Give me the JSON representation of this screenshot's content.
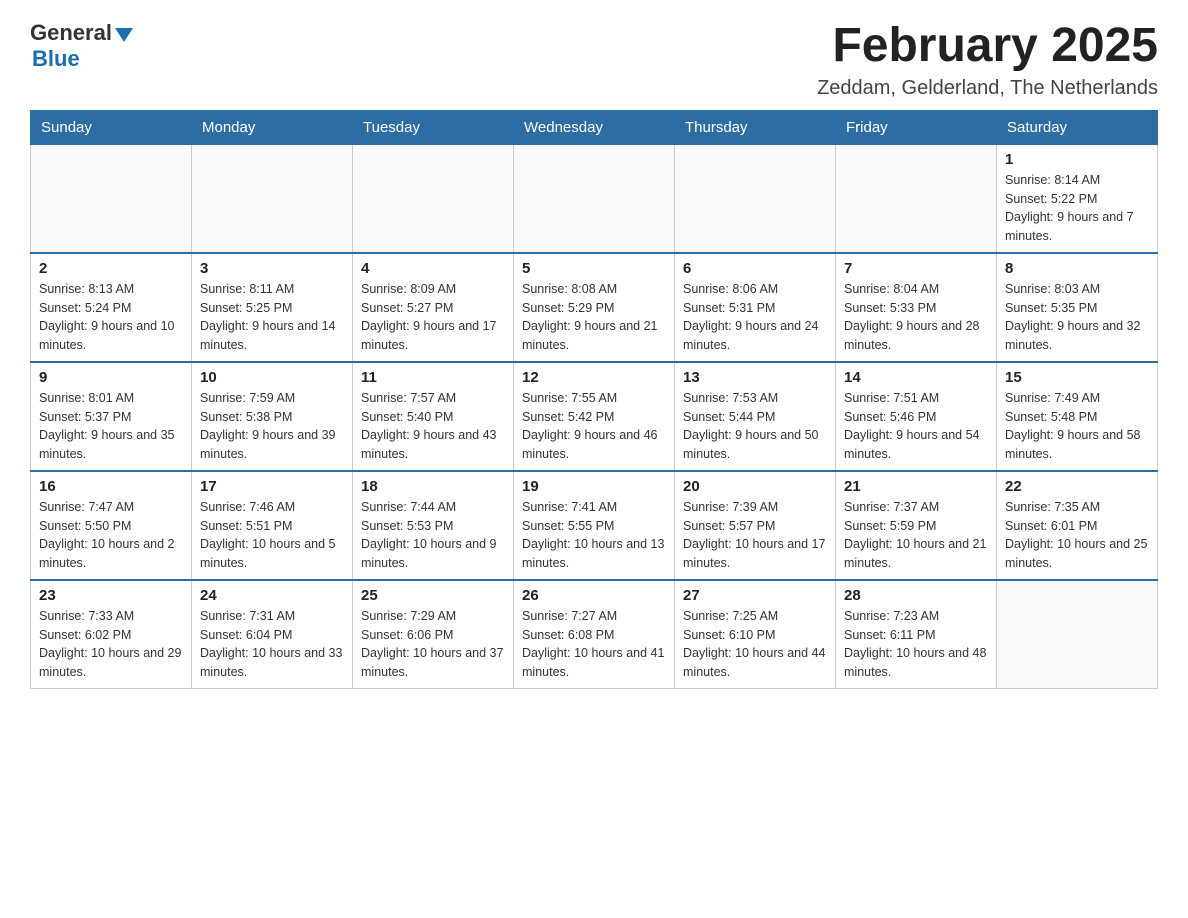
{
  "header": {
    "logo_general": "General",
    "logo_blue": "Blue",
    "title": "February 2025",
    "subtitle": "Zeddam, Gelderland, The Netherlands"
  },
  "weekdays": [
    "Sunday",
    "Monday",
    "Tuesday",
    "Wednesday",
    "Thursday",
    "Friday",
    "Saturday"
  ],
  "weeks": [
    [
      {
        "day": "",
        "info": ""
      },
      {
        "day": "",
        "info": ""
      },
      {
        "day": "",
        "info": ""
      },
      {
        "day": "",
        "info": ""
      },
      {
        "day": "",
        "info": ""
      },
      {
        "day": "",
        "info": ""
      },
      {
        "day": "1",
        "info": "Sunrise: 8:14 AM\nSunset: 5:22 PM\nDaylight: 9 hours and 7 minutes."
      }
    ],
    [
      {
        "day": "2",
        "info": "Sunrise: 8:13 AM\nSunset: 5:24 PM\nDaylight: 9 hours and 10 minutes."
      },
      {
        "day": "3",
        "info": "Sunrise: 8:11 AM\nSunset: 5:25 PM\nDaylight: 9 hours and 14 minutes."
      },
      {
        "day": "4",
        "info": "Sunrise: 8:09 AM\nSunset: 5:27 PM\nDaylight: 9 hours and 17 minutes."
      },
      {
        "day": "5",
        "info": "Sunrise: 8:08 AM\nSunset: 5:29 PM\nDaylight: 9 hours and 21 minutes."
      },
      {
        "day": "6",
        "info": "Sunrise: 8:06 AM\nSunset: 5:31 PM\nDaylight: 9 hours and 24 minutes."
      },
      {
        "day": "7",
        "info": "Sunrise: 8:04 AM\nSunset: 5:33 PM\nDaylight: 9 hours and 28 minutes."
      },
      {
        "day": "8",
        "info": "Sunrise: 8:03 AM\nSunset: 5:35 PM\nDaylight: 9 hours and 32 minutes."
      }
    ],
    [
      {
        "day": "9",
        "info": "Sunrise: 8:01 AM\nSunset: 5:37 PM\nDaylight: 9 hours and 35 minutes."
      },
      {
        "day": "10",
        "info": "Sunrise: 7:59 AM\nSunset: 5:38 PM\nDaylight: 9 hours and 39 minutes."
      },
      {
        "day": "11",
        "info": "Sunrise: 7:57 AM\nSunset: 5:40 PM\nDaylight: 9 hours and 43 minutes."
      },
      {
        "day": "12",
        "info": "Sunrise: 7:55 AM\nSunset: 5:42 PM\nDaylight: 9 hours and 46 minutes."
      },
      {
        "day": "13",
        "info": "Sunrise: 7:53 AM\nSunset: 5:44 PM\nDaylight: 9 hours and 50 minutes."
      },
      {
        "day": "14",
        "info": "Sunrise: 7:51 AM\nSunset: 5:46 PM\nDaylight: 9 hours and 54 minutes."
      },
      {
        "day": "15",
        "info": "Sunrise: 7:49 AM\nSunset: 5:48 PM\nDaylight: 9 hours and 58 minutes."
      }
    ],
    [
      {
        "day": "16",
        "info": "Sunrise: 7:47 AM\nSunset: 5:50 PM\nDaylight: 10 hours and 2 minutes."
      },
      {
        "day": "17",
        "info": "Sunrise: 7:46 AM\nSunset: 5:51 PM\nDaylight: 10 hours and 5 minutes."
      },
      {
        "day": "18",
        "info": "Sunrise: 7:44 AM\nSunset: 5:53 PM\nDaylight: 10 hours and 9 minutes."
      },
      {
        "day": "19",
        "info": "Sunrise: 7:41 AM\nSunset: 5:55 PM\nDaylight: 10 hours and 13 minutes."
      },
      {
        "day": "20",
        "info": "Sunrise: 7:39 AM\nSunset: 5:57 PM\nDaylight: 10 hours and 17 minutes."
      },
      {
        "day": "21",
        "info": "Sunrise: 7:37 AM\nSunset: 5:59 PM\nDaylight: 10 hours and 21 minutes."
      },
      {
        "day": "22",
        "info": "Sunrise: 7:35 AM\nSunset: 6:01 PM\nDaylight: 10 hours and 25 minutes."
      }
    ],
    [
      {
        "day": "23",
        "info": "Sunrise: 7:33 AM\nSunset: 6:02 PM\nDaylight: 10 hours and 29 minutes."
      },
      {
        "day": "24",
        "info": "Sunrise: 7:31 AM\nSunset: 6:04 PM\nDaylight: 10 hours and 33 minutes."
      },
      {
        "day": "25",
        "info": "Sunrise: 7:29 AM\nSunset: 6:06 PM\nDaylight: 10 hours and 37 minutes."
      },
      {
        "day": "26",
        "info": "Sunrise: 7:27 AM\nSunset: 6:08 PM\nDaylight: 10 hours and 41 minutes."
      },
      {
        "day": "27",
        "info": "Sunrise: 7:25 AM\nSunset: 6:10 PM\nDaylight: 10 hours and 44 minutes."
      },
      {
        "day": "28",
        "info": "Sunrise: 7:23 AM\nSunset: 6:11 PM\nDaylight: 10 hours and 48 minutes."
      },
      {
        "day": "",
        "info": ""
      }
    ]
  ]
}
